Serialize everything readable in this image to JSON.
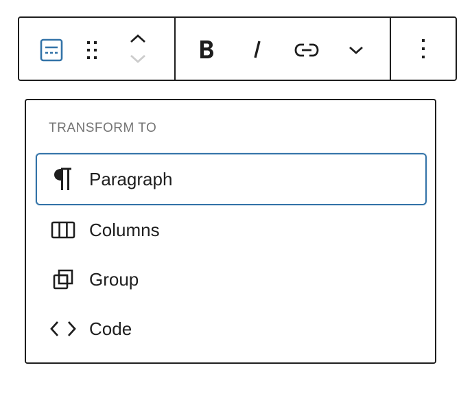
{
  "toolbar": {
    "block_type_icon": "paragraph-block-icon",
    "drag_icon": "drag-handle-icon",
    "move_up_icon": "chevron-up-icon",
    "move_down_icon": "chevron-down-icon",
    "bold_icon": "bold-icon",
    "italic_icon": "italic-icon",
    "link_icon": "link-icon",
    "more_icon": "chevron-down-icon",
    "options_icon": "more-vertical-icon",
    "accent_color": "#3373a8"
  },
  "transform_menu": {
    "title": "TRANSFORM TO",
    "items": [
      {
        "label": "Paragraph",
        "icon": "pilcrow-icon",
        "selected": true
      },
      {
        "label": "Columns",
        "icon": "columns-icon",
        "selected": false
      },
      {
        "label": "Group",
        "icon": "group-icon",
        "selected": false
      },
      {
        "label": "Code",
        "icon": "code-icon",
        "selected": false
      }
    ]
  },
  "colors": {
    "border": "#1e1e1e",
    "selected_border": "#3373a8",
    "section_title": "#757575",
    "disabled_icon": "#cccccc"
  }
}
